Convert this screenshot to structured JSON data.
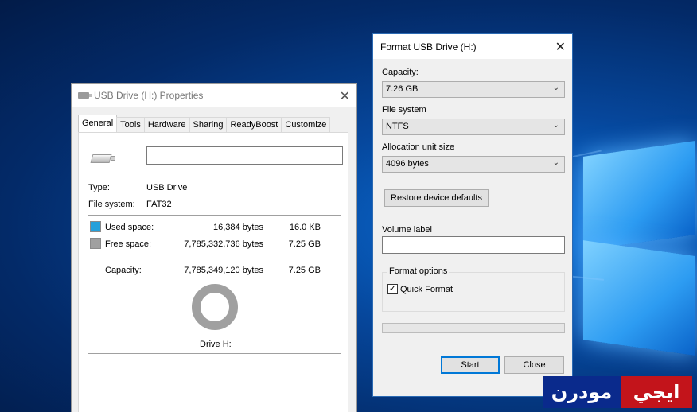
{
  "properties": {
    "title": "USB Drive (H:) Properties",
    "tabs": [
      "General",
      "Tools",
      "Hardware",
      "Sharing",
      "ReadyBoost",
      "Customize"
    ],
    "active_tab": "General",
    "drive_name_value": "",
    "type_label": "Type:",
    "type_value": "USB Drive",
    "fs_label": "File system:",
    "fs_value": "FAT32",
    "used_label": "Used space:",
    "used_bytes": "16,384 bytes",
    "used_size": "16.0 KB",
    "free_label": "Free space:",
    "free_bytes": "7,785,332,736 bytes",
    "free_size": "7.25 GB",
    "capacity_label": "Capacity:",
    "capacity_bytes": "7,785,349,120 bytes",
    "capacity_size": "7.25 GB",
    "drive_caption": "Drive H:",
    "used_color": "#26a0da",
    "free_color": "#a0a0a0"
  },
  "format": {
    "title": "Format USB Drive (H:)",
    "capacity_label": "Capacity:",
    "capacity_value": "7.26 GB",
    "fs_label": "File system",
    "fs_value": "NTFS",
    "alloc_label": "Allocation unit size",
    "alloc_value": "4096 bytes",
    "restore_button": "Restore device defaults",
    "volume_label": "Volume label",
    "volume_value": "",
    "options_legend": "Format options",
    "quick_format_label": "Quick Format",
    "quick_format_checked": true,
    "progress": 0,
    "start_button": "Start",
    "close_button": "Close"
  },
  "watermark": {
    "part1": "مودرن",
    "part2": "ايجي"
  }
}
